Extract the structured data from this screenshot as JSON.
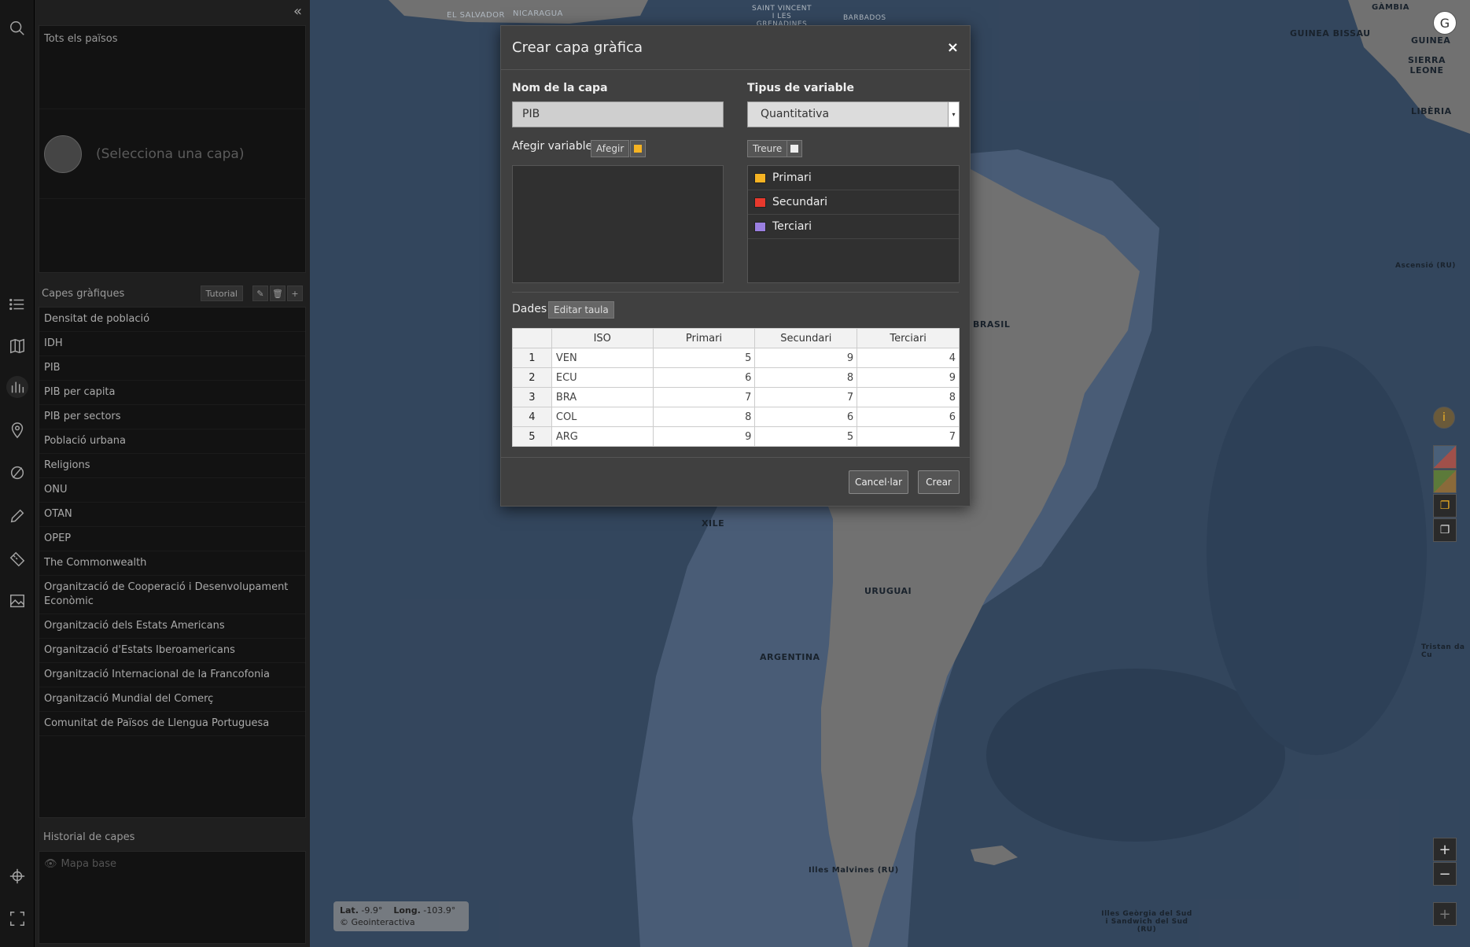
{
  "sidebar": {
    "countries_title": "Tots els països",
    "countries_hint": "(Selecciona una capa)",
    "layers_title": "Capes gràfiques",
    "tutorial_label": "Tutorial",
    "layers": [
      "Densitat de població",
      "IDH",
      "PIB",
      "PIB per capita",
      "PIB per sectors",
      "Població urbana",
      "Religions",
      "ONU",
      "OTAN",
      "OPEP",
      "The Commonwealth",
      "Organització de Cooperació i Desenvolupament Econòmic",
      "Organització dels Estats Americans",
      "Organització d'Estats Iberoamericans",
      "Organització Internacional de la Francofonia",
      "Organització Mundial del Comerç",
      "Comunitat de Països de Llengua Portuguesa"
    ],
    "history_title": "Historial de capes",
    "history_items": [
      "Mapa base"
    ]
  },
  "map": {
    "labels": {
      "el_salvador": "EL SALVADOR",
      "nicaragua": "NICARAGUA",
      "saint_vincent": "SAINT VINCENT I LES GRENADINES",
      "barbados": "BARBADOS",
      "gambia": "GÀMBIA",
      "guinea_bissau": "GUINEA BISSAU",
      "guinea": "GUINEA",
      "sierra_leone": "SIERRA LEONE",
      "liberia": "LIBÈRIA",
      "ascensio": "Ascensió (RU)",
      "brasil": "BRASIL",
      "xile": "XILE",
      "uruguai": "URUGUAI",
      "argentina": "ARGENTINA",
      "tristan": "Tristan da Cu",
      "malvines": "Illes Malvines (RU)",
      "georgia": "Illes Geòrgia del Sud i Sandwich del Sud (RU)"
    },
    "coords": {
      "lat_label": "Lat.",
      "lat": "-9.9°",
      "long_label": "Long.",
      "long": "-103.9°",
      "credit": "© Geointeractiva"
    },
    "zoom_in": "+",
    "zoom_out": "−"
  },
  "modal": {
    "title": "Crear capa gràfica",
    "close": "×",
    "name_label": "Nom de la capa",
    "name_value": "PIB",
    "type_label": "Tipus de variable",
    "type_value": "Quantitativa",
    "add_var_label": "Afegir variable",
    "add_button": "Afegir",
    "remove_button": "Treure",
    "variables": [
      {
        "name": "Primari",
        "color": "#f5b323"
      },
      {
        "name": "Secundari",
        "color": "#e8392d"
      },
      {
        "name": "Terciari",
        "color": "#9a7fe0"
      }
    ],
    "data_label": "Dades",
    "edit_table_button": "Editar taula",
    "table": {
      "headers": [
        "",
        "ISO",
        "Primari",
        "Secundari",
        "Terciari"
      ],
      "rows": [
        [
          "1",
          "VEN",
          "5",
          "9",
          "4"
        ],
        [
          "2",
          "ECU",
          "6",
          "8",
          "9"
        ],
        [
          "3",
          "BRA",
          "7",
          "7",
          "8"
        ],
        [
          "4",
          "COL",
          "8",
          "6",
          "6"
        ],
        [
          "5",
          "ARG",
          "9",
          "5",
          "7"
        ]
      ]
    },
    "cancel_button": "Cancel·lar",
    "create_button": "Crear"
  },
  "colors": {
    "ocean": "#3f5672",
    "land": "#8c8c8c",
    "accent": "#f5b323"
  }
}
